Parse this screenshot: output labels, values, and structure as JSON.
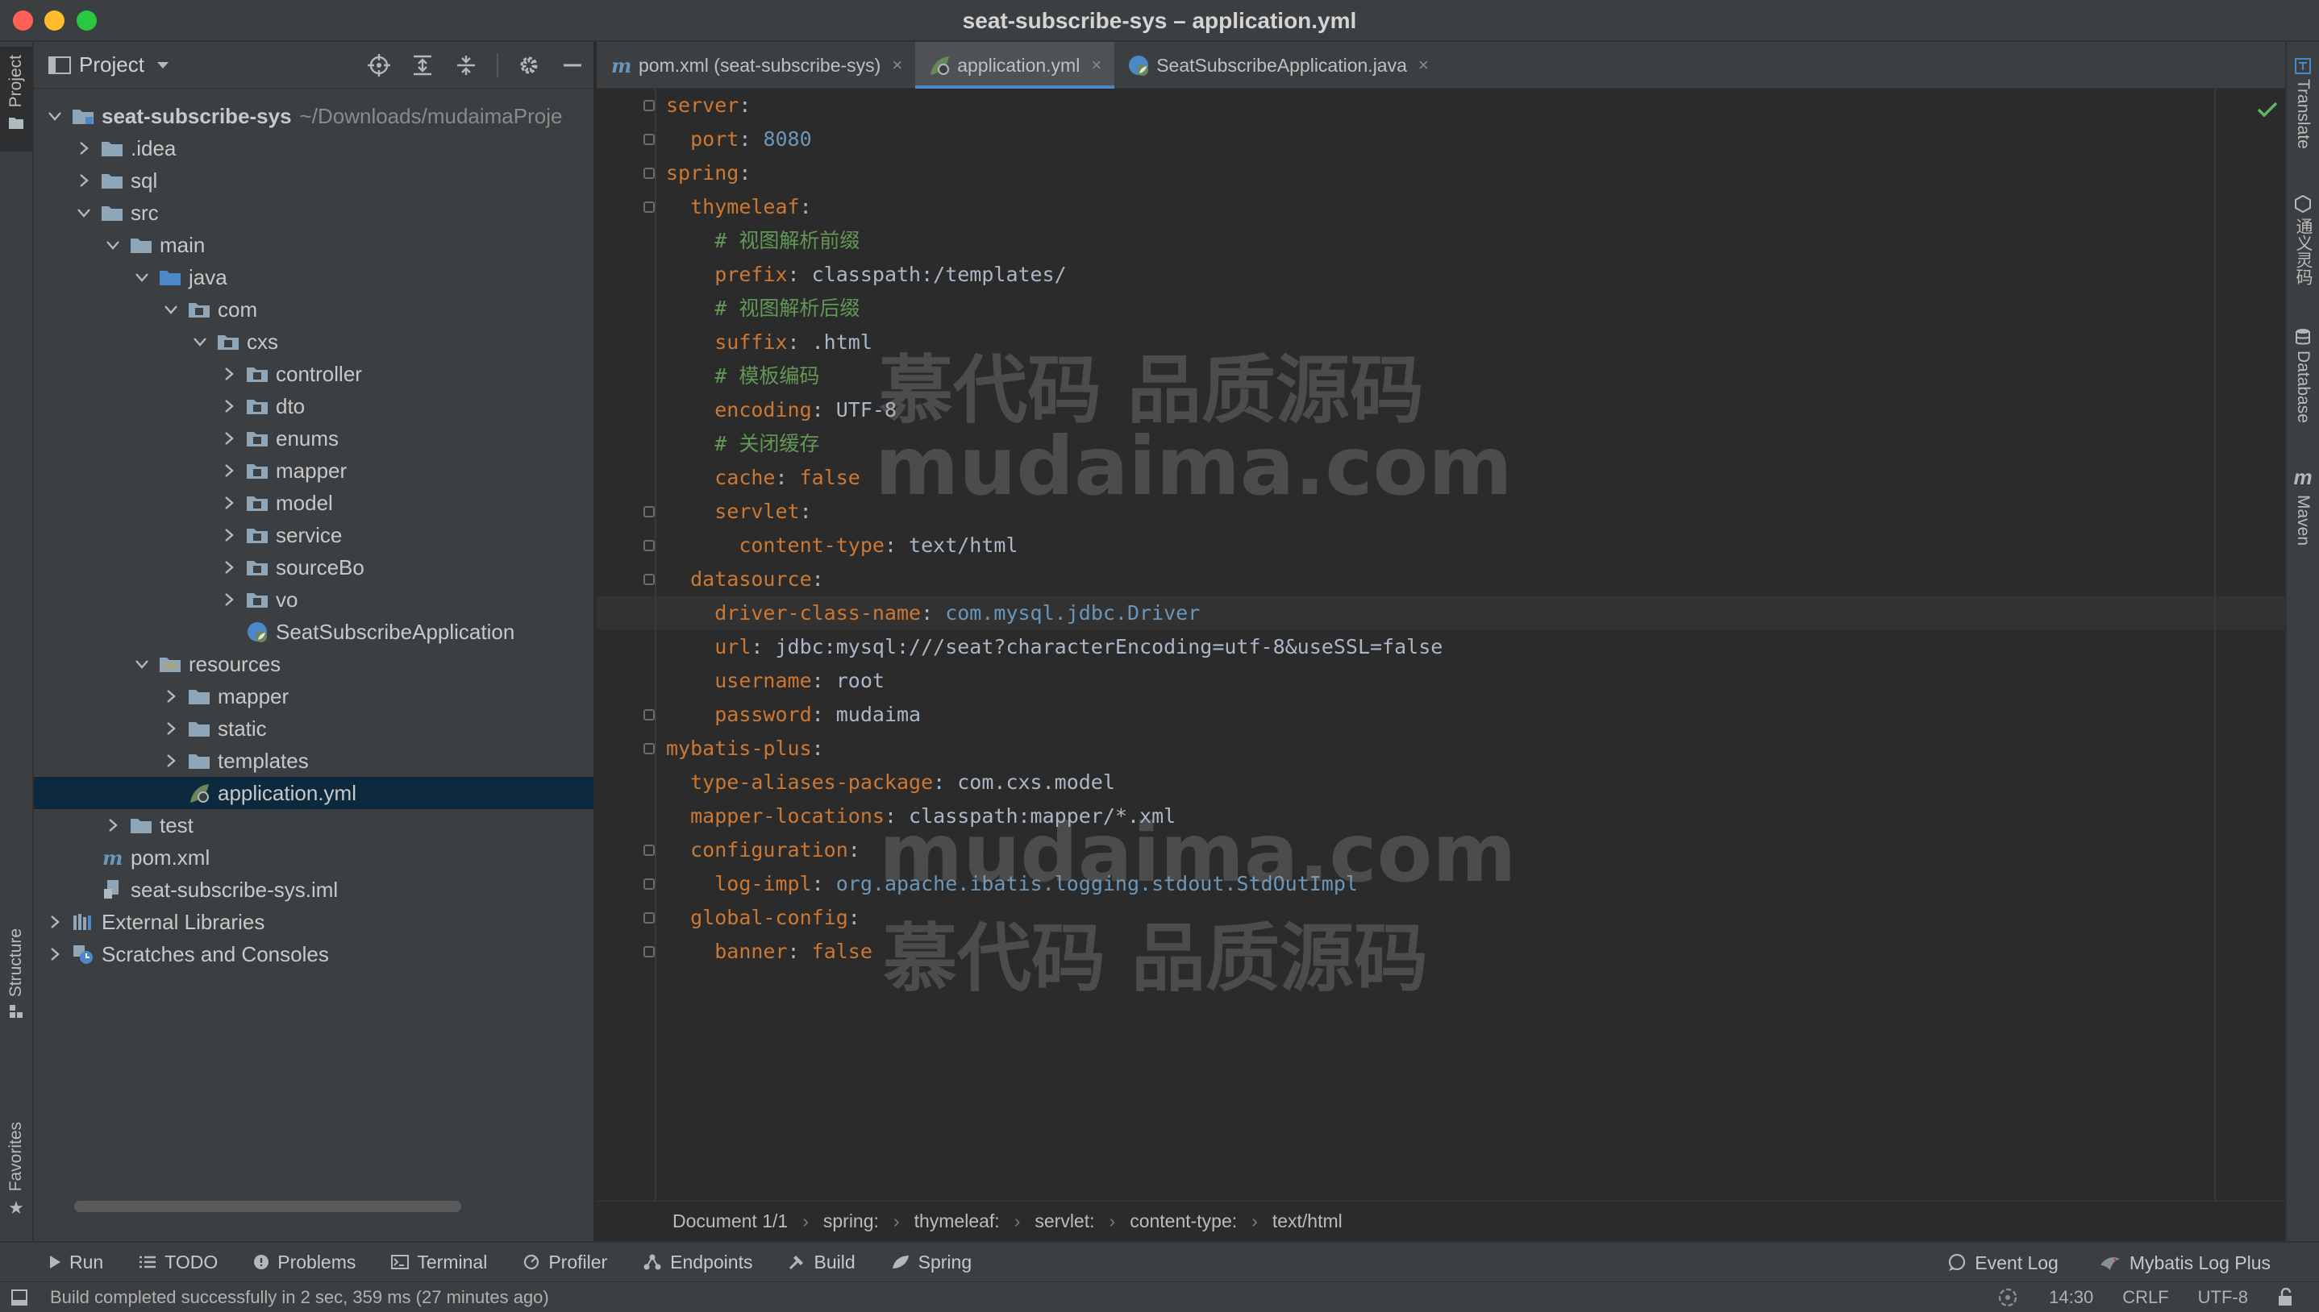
{
  "window": {
    "title": "seat-subscribe-sys – application.yml"
  },
  "left_stripe": {
    "project": "Project",
    "structure": "Structure",
    "favorites": "Favorites"
  },
  "right_stripe": {
    "translate": "Translate",
    "tongyi": "通义灵码",
    "database": "Database",
    "maven": "Maven"
  },
  "project_panel": {
    "title": "Project",
    "tree": [
      {
        "depth": 0,
        "arrow": "down",
        "icon": "module-folder",
        "label": "seat-subscribe-sys",
        "hint": "~/Downloads/mudaimaProje",
        "bold": true
      },
      {
        "depth": 1,
        "arrow": "right",
        "icon": "folder",
        "label": ".idea"
      },
      {
        "depth": 1,
        "arrow": "right",
        "icon": "folder",
        "label": "sql"
      },
      {
        "depth": 1,
        "arrow": "down",
        "icon": "folder",
        "label": "src"
      },
      {
        "depth": 2,
        "arrow": "down",
        "icon": "folder",
        "label": "main"
      },
      {
        "depth": 3,
        "arrow": "down",
        "icon": "source-folder",
        "label": "java"
      },
      {
        "depth": 4,
        "arrow": "down",
        "icon": "package",
        "label": "com"
      },
      {
        "depth": 5,
        "arrow": "down",
        "icon": "package",
        "label": "cxs"
      },
      {
        "depth": 6,
        "arrow": "right",
        "icon": "package",
        "label": "controller"
      },
      {
        "depth": 6,
        "arrow": "right",
        "icon": "package",
        "label": "dto"
      },
      {
        "depth": 6,
        "arrow": "right",
        "icon": "package",
        "label": "enums"
      },
      {
        "depth": 6,
        "arrow": "right",
        "icon": "package",
        "label": "mapper"
      },
      {
        "depth": 6,
        "arrow": "right",
        "icon": "package",
        "label": "model"
      },
      {
        "depth": 6,
        "arrow": "right",
        "icon": "package",
        "label": "service"
      },
      {
        "depth": 6,
        "arrow": "right",
        "icon": "package",
        "label": "sourceBo"
      },
      {
        "depth": 6,
        "arrow": "right",
        "icon": "package",
        "label": "vo"
      },
      {
        "depth": 6,
        "arrow": "none",
        "icon": "spring-class",
        "label": "SeatSubscribeApplication"
      },
      {
        "depth": 3,
        "arrow": "down",
        "icon": "resources-folder",
        "label": "resources"
      },
      {
        "depth": 4,
        "arrow": "right",
        "icon": "folder",
        "label": "mapper"
      },
      {
        "depth": 4,
        "arrow": "right",
        "icon": "folder",
        "label": "static"
      },
      {
        "depth": 4,
        "arrow": "right",
        "icon": "folder",
        "label": "templates"
      },
      {
        "depth": 4,
        "arrow": "none",
        "icon": "yml-file",
        "label": "application.yml",
        "selected": true
      },
      {
        "depth": 2,
        "arrow": "right",
        "icon": "folder",
        "label": "test"
      },
      {
        "depth": 1,
        "arrow": "none",
        "icon": "maven-file",
        "label": "pom.xml"
      },
      {
        "depth": 1,
        "arrow": "none",
        "icon": "iml-file",
        "label": "seat-subscribe-sys.iml"
      },
      {
        "depth": 0,
        "arrow": "right",
        "icon": "libraries",
        "label": "External Libraries"
      },
      {
        "depth": 0,
        "arrow": "right",
        "icon": "scratches",
        "label": "Scratches and Consoles"
      }
    ]
  },
  "tabs": [
    {
      "icon": "maven-file",
      "label": "pom.xml (seat-subscribe-sys)",
      "active": false
    },
    {
      "icon": "yml-file",
      "label": "application.yml",
      "active": true
    },
    {
      "icon": "spring-class",
      "label": "SeatSubscribeApplication.java",
      "active": false
    }
  ],
  "tab_close": "×",
  "editor": {
    "lines": [
      [
        [
          "k",
          "server"
        ],
        [
          "v",
          ":"
        ]
      ],
      [
        [
          "v",
          "  "
        ],
        [
          "k",
          "port"
        ],
        [
          "v",
          ": "
        ],
        [
          "n",
          "8080"
        ]
      ],
      [
        [
          "k",
          "spring"
        ],
        [
          "v",
          ":"
        ]
      ],
      [
        [
          "v",
          "  "
        ],
        [
          "k",
          "thymeleaf"
        ],
        [
          "v",
          ":"
        ]
      ],
      [
        [
          "v",
          "    "
        ],
        [
          "c",
          "# 视图解析前缀"
        ]
      ],
      [
        [
          "v",
          "    "
        ],
        [
          "k",
          "prefix"
        ],
        [
          "v",
          ": classpath:/templates/"
        ]
      ],
      [
        [
          "v",
          "    "
        ],
        [
          "c",
          "# 视图解析后缀"
        ]
      ],
      [
        [
          "v",
          "    "
        ],
        [
          "k",
          "suffix"
        ],
        [
          "v",
          ": .html"
        ]
      ],
      [
        [
          "v",
          "    "
        ],
        [
          "c",
          "# 模板编码"
        ]
      ],
      [
        [
          "v",
          "    "
        ],
        [
          "k",
          "encoding"
        ],
        [
          "v",
          ": UTF-8"
        ]
      ],
      [
        [
          "v",
          "    "
        ],
        [
          "c",
          "# 关闭缓存"
        ]
      ],
      [
        [
          "v",
          "    "
        ],
        [
          "k",
          "cache"
        ],
        [
          "v",
          ": "
        ],
        [
          "k",
          "false"
        ]
      ],
      [
        [
          "v",
          "    "
        ],
        [
          "k",
          "servlet"
        ],
        [
          "v",
          ":"
        ]
      ],
      [
        [
          "v",
          "      "
        ],
        [
          "k",
          "content-type"
        ],
        [
          "v",
          ": text/html"
        ]
      ],
      [
        [
          "v",
          "  "
        ],
        [
          "k",
          "datasource"
        ],
        [
          "v",
          ":"
        ]
      ],
      [
        [
          "v",
          "    "
        ],
        [
          "k",
          "driver-class-name"
        ],
        [
          "v",
          ": "
        ],
        [
          "n",
          "com.mysql.jdbc.Driver"
        ]
      ],
      [
        [
          "v",
          "    "
        ],
        [
          "k",
          "url"
        ],
        [
          "v",
          ": jdbc:mysql:///seat?characterEncoding=utf-8&useSSL=false"
        ]
      ],
      [
        [
          "v",
          "    "
        ],
        [
          "k",
          "username"
        ],
        [
          "v",
          ": root"
        ]
      ],
      [
        [
          "v",
          "    "
        ],
        [
          "k",
          "password"
        ],
        [
          "v",
          ": mudaima"
        ]
      ],
      [
        [
          "k",
          "mybatis-plus"
        ],
        [
          "v",
          ":"
        ]
      ],
      [
        [
          "v",
          "  "
        ],
        [
          "k",
          "type-aliases-package"
        ],
        [
          "v",
          ": com.cxs.model"
        ]
      ],
      [
        [
          "v",
          "  "
        ],
        [
          "k",
          "mapper-locations"
        ],
        [
          "v",
          ": classpath:mapper/*.xml"
        ]
      ],
      [
        [
          "v",
          "  "
        ],
        [
          "k",
          "configuration"
        ],
        [
          "v",
          ":"
        ]
      ],
      [
        [
          "v",
          "    "
        ],
        [
          "k",
          "log-impl"
        ],
        [
          "v",
          ": "
        ],
        [
          "n",
          "org.apache.ibatis.logging.stdout.StdOutImpl"
        ]
      ],
      [
        [
          "v",
          "  "
        ],
        [
          "k",
          "global-config"
        ],
        [
          "v",
          ":"
        ]
      ],
      [
        [
          "v",
          "    "
        ],
        [
          "k",
          "banner"
        ],
        [
          "v",
          ": "
        ],
        [
          "k",
          "false"
        ]
      ]
    ],
    "watermarks": [
      "慕代码 品质源码",
      "mudaima.com",
      "mudaima.com",
      "慕代码 品质源码"
    ]
  },
  "breadcrumbs": [
    "Document 1/1",
    "spring:",
    "thymeleaf:",
    "servlet:",
    "content-type:",
    "text/html"
  ],
  "breadcrumb_sep": "›",
  "bottom_tools": {
    "run": "Run",
    "todo": "TODO",
    "problems": "Problems",
    "terminal": "Terminal",
    "profiler": "Profiler",
    "endpoints": "Endpoints",
    "build": "Build",
    "spring": "Spring",
    "event_log": "Event Log",
    "mybatis_log": "Mybatis Log Plus"
  },
  "status": {
    "message": "Build completed successfully in 2 sec, 359 ms (27 minutes ago)",
    "time": "14:30",
    "line_sep": "CRLF",
    "encoding": "UTF-8"
  }
}
